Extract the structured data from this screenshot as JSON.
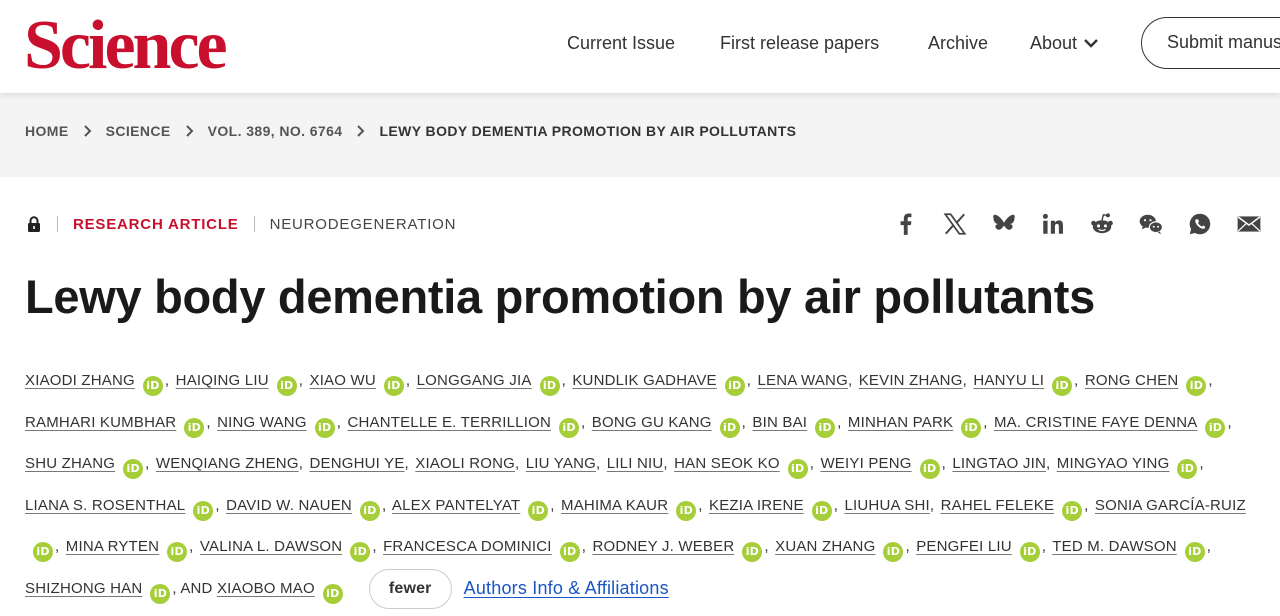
{
  "header": {
    "logo": "Science",
    "nav": [
      "Current Issue",
      "First release papers",
      "Archive"
    ],
    "about_label": "About",
    "submit_label": "Submit manuscript"
  },
  "breadcrumb": [
    "HOME",
    "SCIENCE",
    "VOL. 389, NO. 6764",
    "LEWY BODY DEMENTIA PROMOTION BY AIR POLLUTANTS"
  ],
  "article": {
    "type": "RESEARCH ARTICLE",
    "topic": "NEURODEGENERATION",
    "title": "Lewy body dementia promotion by air pollutants"
  },
  "share_icons": [
    "facebook-icon",
    "x-icon",
    "bluesky-icon",
    "linkedin-icon",
    "reddit-icon",
    "wechat-icon",
    "whatsapp-icon",
    "email-icon"
  ],
  "orcid_badge": "iD",
  "authors": [
    {
      "name": "XIAODI ZHANG",
      "orcid": true
    },
    {
      "name": "HAIQING LIU",
      "orcid": true
    },
    {
      "name": "XIAO WU",
      "orcid": true
    },
    {
      "name": "LONGGANG JIA",
      "orcid": true
    },
    {
      "name": "KUNDLIK GADHAVE",
      "orcid": true
    },
    {
      "name": "LENA WANG",
      "orcid": false
    },
    {
      "name": "KEVIN ZHANG",
      "orcid": false
    },
    {
      "name": "HANYU LI",
      "orcid": true
    },
    {
      "name": "RONG CHEN",
      "orcid": true
    },
    {
      "name": "RAMHARI KUMBHAR",
      "orcid": true
    },
    {
      "name": "NING WANG",
      "orcid": true
    },
    {
      "name": "CHANTELLE E. TERRILLION",
      "orcid": true
    },
    {
      "name": "BONG GU KANG",
      "orcid": true
    },
    {
      "name": "BIN BAI",
      "orcid": true
    },
    {
      "name": "MINHAN PARK",
      "orcid": true
    },
    {
      "name": "MA. CRISTINE FAYE DENNA",
      "orcid": true
    },
    {
      "name": "SHU ZHANG",
      "orcid": true
    },
    {
      "name": "WENQIANG ZHENG",
      "orcid": false
    },
    {
      "name": "DENGHUI YE",
      "orcid": false
    },
    {
      "name": "XIAOLI RONG",
      "orcid": false
    },
    {
      "name": "LIU YANG",
      "orcid": false
    },
    {
      "name": "LILI NIU",
      "orcid": false
    },
    {
      "name": "HAN SEOK KO",
      "orcid": true
    },
    {
      "name": "WEIYI PENG",
      "orcid": true
    },
    {
      "name": "LINGTAO JIN",
      "orcid": false
    },
    {
      "name": "MINGYAO YING",
      "orcid": true
    },
    {
      "name": "LIANA S. ROSENTHAL",
      "orcid": true
    },
    {
      "name": "DAVID W. NAUEN",
      "orcid": true
    },
    {
      "name": "ALEX PANTELYAT",
      "orcid": true
    },
    {
      "name": "MAHIMA KAUR",
      "orcid": true
    },
    {
      "name": "KEZIA IRENE",
      "orcid": true
    },
    {
      "name": "LIUHUA SHI",
      "orcid": false
    },
    {
      "name": "RAHEL FELEKE",
      "orcid": true
    },
    {
      "name": "SONIA GARCÍA-RUIZ",
      "orcid": true
    },
    {
      "name": "MINA RYTEN",
      "orcid": true
    },
    {
      "name": "VALINA L. DAWSON",
      "orcid": true
    },
    {
      "name": "FRANCESCA DOMINICI",
      "orcid": true
    },
    {
      "name": "RODNEY J. WEBER",
      "orcid": true
    },
    {
      "name": "XUAN ZHANG",
      "orcid": true
    },
    {
      "name": "PENGFEI LIU",
      "orcid": true
    },
    {
      "name": "TED M. DAWSON",
      "orcid": true
    },
    {
      "name": "SHIZHONG HAN",
      "orcid": true
    },
    {
      "name": "XIAOBO MAO",
      "orcid": true
    }
  ],
  "and_label": ", AND ",
  "fewer_label": "fewer",
  "affiliations_label": "Authors Info & Affiliations"
}
